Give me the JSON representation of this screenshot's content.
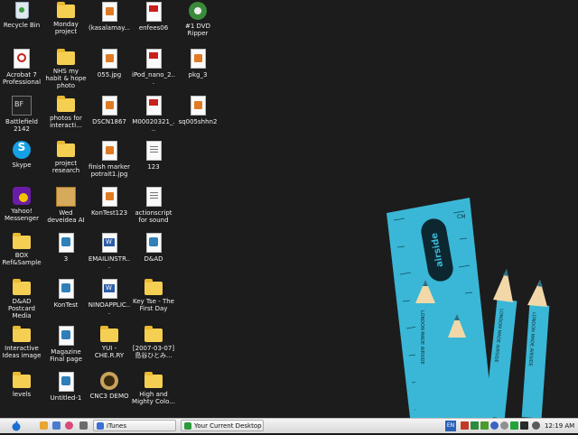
{
  "desktop_icons": [
    {
      "label": "Recycle Bin"
    },
    {
      "label": "Monday project"
    },
    {
      "label": "(kasalamay..."
    },
    {
      "label": "enfees06"
    },
    {
      "label": "#1 DVD Ripper"
    },
    {
      "label": "Acrobat 7 Professional"
    },
    {
      "label": "NHS my habit & hope photo"
    },
    {
      "label": "055.jpg"
    },
    {
      "label": "iPod_nano_2..."
    },
    {
      "label": "pkg_3"
    },
    {
      "label": "Battlefield 2142"
    },
    {
      "label": "photos for interacti..."
    },
    {
      "label": "DSCN1867"
    },
    {
      "label": "M00020321_..."
    },
    {
      "label": "sq005shhn2"
    },
    {
      "label": "Skype"
    },
    {
      "label": "project research"
    },
    {
      "label": "finish marker potrait1.jpg"
    },
    {
      "label": "123"
    },
    {
      "label": "Yahoo! Messenger"
    },
    {
      "label": "Wed deveidea AI"
    },
    {
      "label": "KonTest123"
    },
    {
      "label": "actionscript for sound"
    },
    {
      "label": "BOX Ref&Sample"
    },
    {
      "label": "3"
    },
    {
      "label": "EMAILINSTR..."
    },
    {
      "label": "D&AD"
    },
    {
      "label": "D&AD Postcard Media"
    },
    {
      "label": "KonTest"
    },
    {
      "label": "NINOAPPLIC..."
    },
    {
      "label": "Key Tse - The First Day"
    },
    {
      "label": "Interactive Ideas image"
    },
    {
      "label": "Magazine Final page"
    },
    {
      "label": "YUI - CHE.R.RY"
    },
    {
      "label": "[2007-03-07] 島谷ひとみ..."
    },
    {
      "label": "levels"
    },
    {
      "label": "Untitled-1"
    },
    {
      "label": "CNC3 DEMO"
    },
    {
      "label": "High and Mighty Colo..."
    }
  ],
  "wallpaper": {
    "ruler_brand": "airside",
    "ruler_unit": "CM",
    "pencil_text": "LONDON MADE AIRSIDE"
  },
  "taskbar": {
    "tasks": [
      {
        "label": "iTunes"
      },
      {
        "label": "Your Current Desktop ..."
      }
    ],
    "language": "EN",
    "clock": "12:19 AM"
  },
  "colors": {
    "desktop_bg": "#1c1c1c",
    "ruler": "#3ab7d6",
    "pencil": "#3ab7d6",
    "taskbar_bg": "#e6e6e6"
  }
}
